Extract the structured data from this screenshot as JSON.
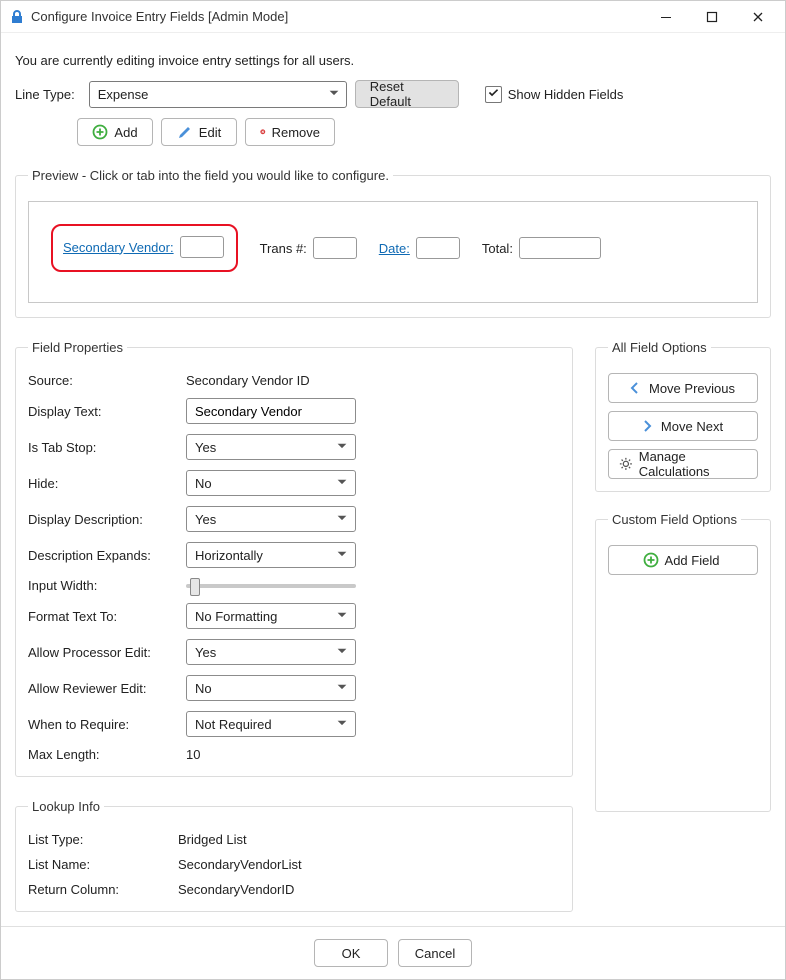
{
  "window": {
    "title": "Configure Invoice Entry Fields [Admin Mode]"
  },
  "intro": "You are currently editing invoice entry settings for all users.",
  "lineType": {
    "label": "Line Type:",
    "value": "Expense"
  },
  "buttons": {
    "resetDefault": "Reset Default",
    "add": "Add",
    "edit": "Edit",
    "remove": "Remove",
    "ok": "OK",
    "cancel": "Cancel"
  },
  "showHidden": {
    "label": "Show Hidden Fields",
    "checked": true
  },
  "preview": {
    "legend": "Preview - Click or tab into the field you would like to configure.",
    "fields": {
      "secondaryVendor": "Secondary Vendor:",
      "transNum": "Trans #:",
      "date": "Date:",
      "total": "Total:"
    }
  },
  "fieldProperties": {
    "legend": "Field Properties",
    "sourceLabel": "Source:",
    "sourceValue": "Secondary Vendor ID",
    "displayTextLabel": "Display Text:",
    "displayTextValue": "Secondary Vendor",
    "tabStopLabel": "Is Tab Stop:",
    "tabStopValue": "Yes",
    "hideLabel": "Hide:",
    "hideValue": "No",
    "displayDescLabel": "Display Description:",
    "displayDescValue": "Yes",
    "descExpandsLabel": "Description Expands:",
    "descExpandsValue": "Horizontally",
    "inputWidthLabel": "Input Width:",
    "formatLabel": "Format Text To:",
    "formatValue": "No Formatting",
    "procEditLabel": "Allow Processor Edit:",
    "procEditValue": "Yes",
    "revEditLabel": "Allow Reviewer Edit:",
    "revEditValue": "No",
    "whenReqLabel": "When to Require:",
    "whenReqValue": "Not Required",
    "maxLenLabel": "Max Length:",
    "maxLenValue": "10"
  },
  "allFieldOptions": {
    "legend": "All Field Options",
    "movePrev": "Move Previous",
    "moveNext": "Move Next",
    "manageCalc": "Manage Calculations"
  },
  "customFieldOptions": {
    "legend": "Custom Field Options",
    "addField": "Add Field"
  },
  "lookup": {
    "legend": "Lookup Info",
    "listTypeLabel": "List Type:",
    "listTypeValue": "Bridged List",
    "listNameLabel": "List Name:",
    "listNameValue": "SecondaryVendorList",
    "returnColLabel": "Return Column:",
    "returnColValue": "SecondaryVendorID"
  }
}
